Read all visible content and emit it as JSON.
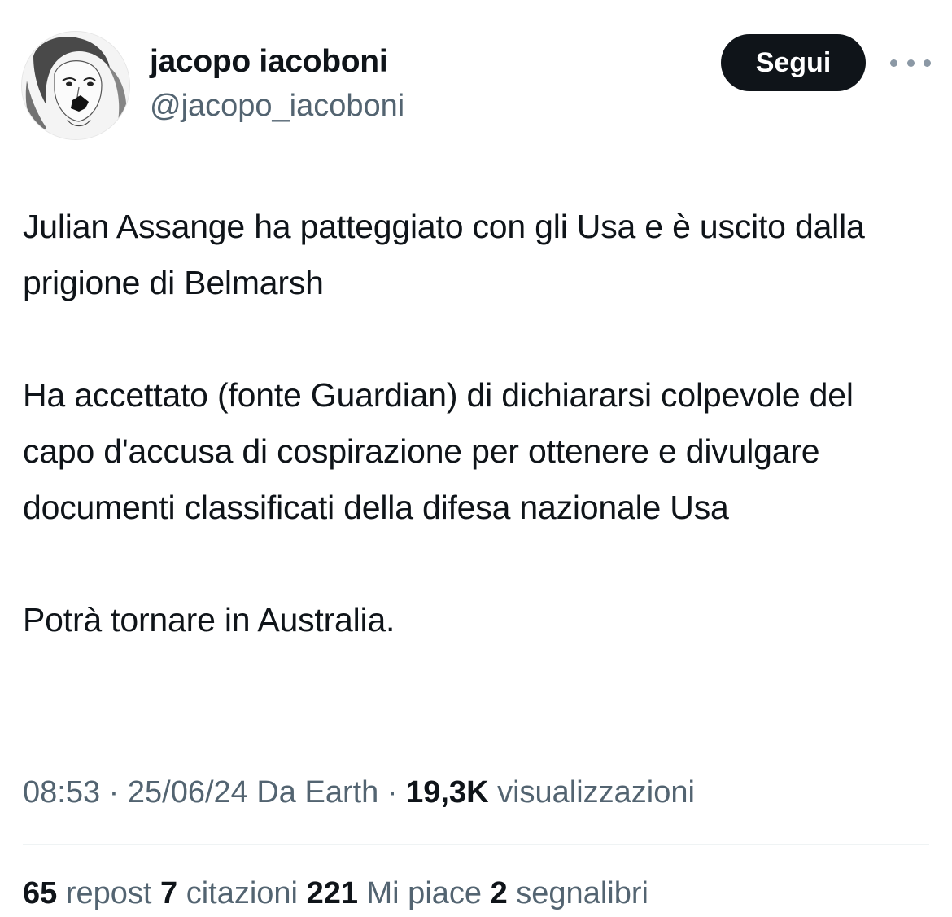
{
  "author": {
    "display_name": "jacopo iacoboni",
    "handle": "@jacopo_iacoboni",
    "avatar_icon": "sketch-portrait-avatar"
  },
  "actions": {
    "follow_label": "Segui",
    "more_icon": "more-horizontal-icon"
  },
  "tweet": {
    "paragraphs": [
      "Julian Assange ha patteggiato con gli Usa e è uscito dalla prigione di Belmarsh",
      "Ha accettato (fonte Guardian) di dichiararsi colpevole del capo d'accusa di cospirazione per ottenere e divulgare documenti classificati della difesa nazionale Usa",
      "Potrà tornare in Australia."
    ]
  },
  "meta": {
    "time": "08:53",
    "sep1": " · ",
    "date": "25/06/24",
    "source": " Da Earth",
    "sep2": " · ",
    "views_count": "19,3K",
    "views_label": " visualizzazioni"
  },
  "stats": {
    "reposts_count": "65",
    "reposts_label": " repost",
    "quotes_count": "7",
    "quotes_label": " citazioni",
    "likes_count": "221",
    "likes_label": " Mi piace",
    "bookmarks_count": "2",
    "bookmarks_label": " segnalibri"
  },
  "colors": {
    "text_primary": "#0f1419",
    "text_secondary": "#536471",
    "button_bg": "#0f1419",
    "divider": "#eff3f4"
  }
}
